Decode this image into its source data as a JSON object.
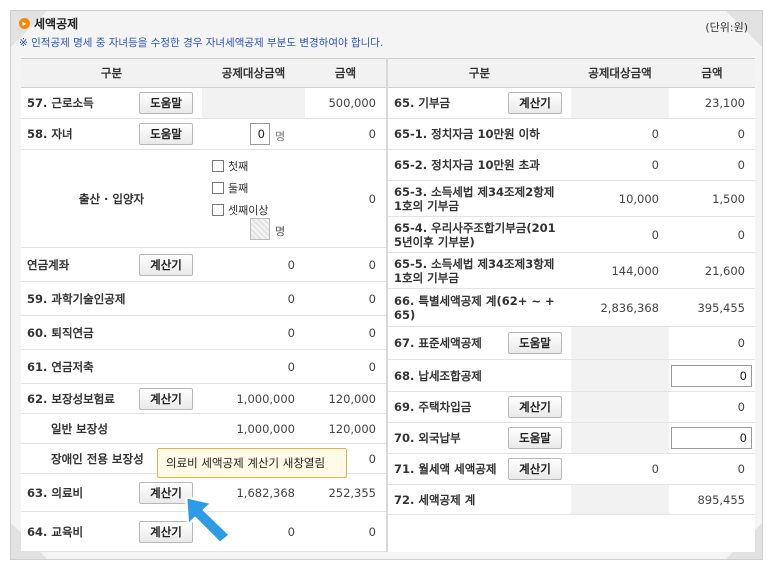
{
  "section": {
    "title": "세액공제",
    "unit": "(단위:원)",
    "note": "※ 인적공제 명세 중 자녀등을 수정한 경우 자녀세액공제 부분도 변경하여야 합니다."
  },
  "headers": {
    "category": "구분",
    "base": "공제대상금액",
    "amount": "금액"
  },
  "left": {
    "r57": {
      "label": "57. 근로소득",
      "btn": "도움말",
      "base": "",
      "amount": "500,000"
    },
    "r58": {
      "label": "58. 자녀",
      "btn": "도움말",
      "count": "0",
      "count_unit": "명",
      "amount": "0"
    },
    "birth": {
      "label": "출산 · 입양자",
      "opt1": "첫째",
      "opt2": "둘째",
      "opt3": "셋째이상",
      "count_unit": "명",
      "amount": "0"
    },
    "pension": {
      "label": "연금계좌",
      "btn": "계산기",
      "base": "0",
      "amount": "0"
    },
    "r59": {
      "label": "59. 과학기술인공제",
      "base": "0",
      "amount": "0"
    },
    "r60": {
      "label": "60. 퇴직연금",
      "base": "0",
      "amount": "0"
    },
    "r61": {
      "label": "61. 연금저축",
      "base": "0",
      "amount": "0"
    },
    "r62": {
      "label": "62. 보장성보험료",
      "btn": "계산기",
      "base": "1,000,000",
      "amount": "120,000"
    },
    "general": {
      "label": "일반 보장성",
      "base": "1,000,000",
      "amount": "120,000"
    },
    "disabled": {
      "label": "장애인 전용 보장성",
      "amount": "0"
    },
    "r63": {
      "label": "63. 의료비",
      "btn": "계산기",
      "base": "1,682,368",
      "amount": "252,355"
    },
    "r64": {
      "label": "64. 교육비",
      "btn": "계산기",
      "base": "0",
      "amount": "0"
    }
  },
  "right": {
    "r65": {
      "label": "65. 기부금",
      "btn": "계산기",
      "base": "",
      "amount": "23,100"
    },
    "r65_1": {
      "label": "65-1. 정치자금 10만원 이하",
      "base": "0",
      "amount": "0"
    },
    "r65_2": {
      "label": "65-2. 정치자금 10만원 초과",
      "base": "0",
      "amount": "0"
    },
    "r65_3": {
      "label1": "65-3. 소득세법 제34조제2항제",
      "label2": "1호의 기부금",
      "base": "10,000",
      "amount": "1,500"
    },
    "r65_4": {
      "label1": "65-4. 우리사주조합기부금(201",
      "label2": "5년이후 기부분)",
      "base": "0",
      "amount": "0"
    },
    "r65_5": {
      "label1": "65-5. 소득세법 제34조제3항제",
      "label2": "1호의 기부금",
      "base": "144,000",
      "amount": "21,600"
    },
    "r66": {
      "label1": "66. 특별세액공제 계(62+ ~ +",
      "label2": "65)",
      "base": "2,836,368",
      "amount": "395,455"
    },
    "r67": {
      "label": "67. 표준세액공제",
      "btn": "도움말",
      "amount": "0"
    },
    "r68": {
      "label": "68. 납세조합공제",
      "input": "0"
    },
    "r69": {
      "label": "69. 주택차입금",
      "btn": "계산기",
      "amount": "0"
    },
    "r70": {
      "label": "70. 외국납부",
      "btn": "도움말",
      "input": "0"
    },
    "r71": {
      "label": "71. 월세액 세액공제",
      "btn": "계산기",
      "base": "0",
      "amount": "0"
    },
    "r72": {
      "label": "72. 세액공제 계",
      "amount": "895,455"
    }
  },
  "tooltip": {
    "text": "의료비 세액공제 계산기 새창열림"
  },
  "colors": {
    "accent": "#f08a00",
    "note": "#2b56b8",
    "tooltip_bg": "#fffbe6",
    "arrow": "#2f9be6"
  }
}
